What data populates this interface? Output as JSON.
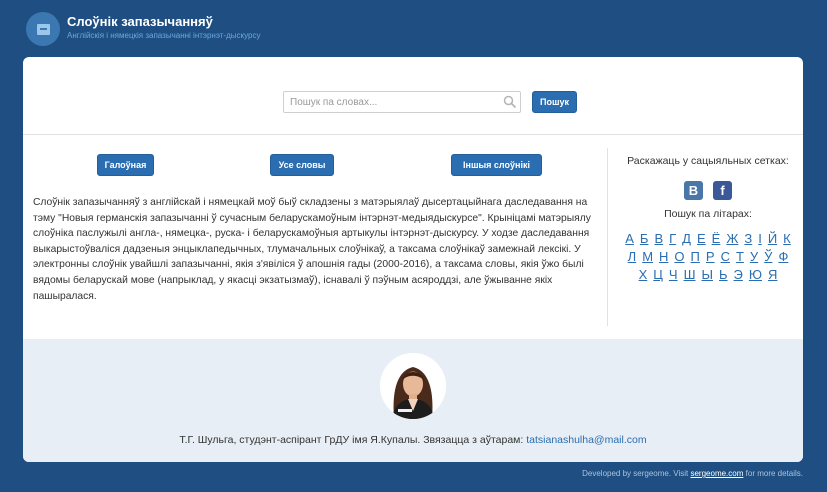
{
  "header": {
    "title": "Слоўнік запазычанняў",
    "subtitle": "Англійскія і нямецкія запазычанні інтэрнэт-дыскурсу"
  },
  "search": {
    "placeholder": "Пошук па словах...",
    "button_label": "Пошук"
  },
  "nav": {
    "home": "Галоўная",
    "all_words": "Усе словы",
    "other_dicts": "Іншыя слоўнікі"
  },
  "description": "Слоўнік запазычанняў з англійскай і нямецкай моў быў складзены з матэрыялаў дысертацыйнага даследавання на тэму \"Новыя германскія запазычанні ў сучасным беларускамоўным інтэрнэт-медыядыскурсе\". Крыніцамі матэрыялу слоўніка паслужылі англа-, нямецка-, руска- і беларускамоўныя артыкулы інтэрнэт-дыскурсу. У ходзе даследавання выкарыстоўваліся дадзеныя энцыклапедычных, тлумачальных слоўнікаў, а таксама слоўнікаў замежнай лексікі. У электронны слоўнік увайшлі запазычанні, якія з'явіліся ў апошнія гады (2000-2016), а таксама словы, якія ўжо былі вядомы беларускай мове (напрыклад, у якасці экзатызмаў), існавалі ў пэўным асяроддзі, але ўжыванне якіх пашыралася.",
  "sidebar": {
    "share_title": "Раскажаць у сацыяльных сетках:",
    "socials": [
      {
        "name": "vk-icon",
        "glyph": "В"
      },
      {
        "name": "facebook-icon",
        "glyph": "f"
      }
    ],
    "letters_title": "Пошук па літарах:",
    "letters": [
      "А",
      "Б",
      "В",
      "Г",
      "Д",
      "Е",
      "Ё",
      "Ж",
      "З",
      "І",
      "Й",
      "К",
      "Л",
      "М",
      "Н",
      "О",
      "П",
      "Р",
      "С",
      "Т",
      "У",
      "Ў",
      "Ф",
      "Х",
      "Ц",
      "Ч",
      "Ш",
      "Ы",
      "Ь",
      "Э",
      "Ю",
      "Я"
    ]
  },
  "footer": {
    "author_text": "Т.Г. Шульга, студэнт-аспірант ГрДУ імя Я.Купалы. Звязацца з аўтарам:",
    "email": "tatsianashulha@mail.com"
  },
  "developed": {
    "prefix": "Developed by sergeome. Visit",
    "link": "sergeome.com",
    "suffix": "for more details."
  },
  "colors": {
    "background": "#1f4f82",
    "accent": "#2a6db0",
    "footer_band": "#e8eef5"
  }
}
